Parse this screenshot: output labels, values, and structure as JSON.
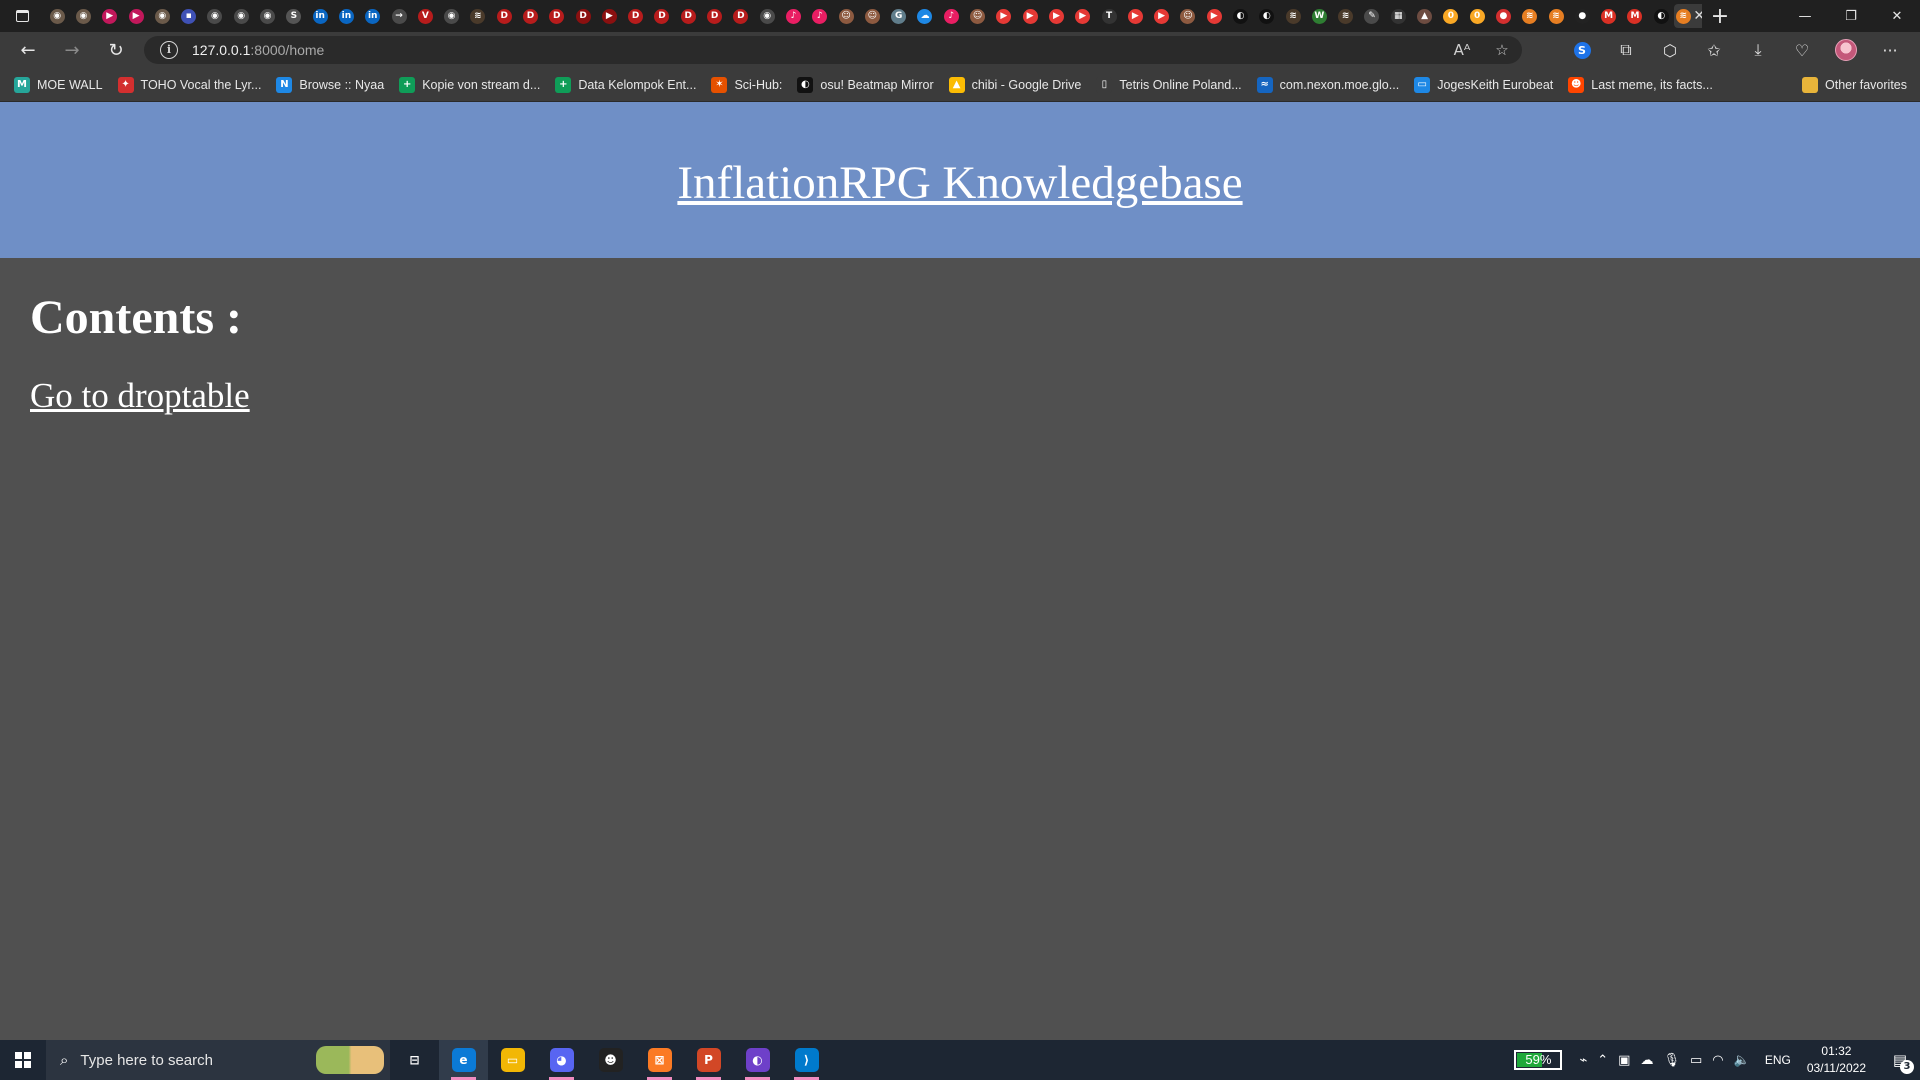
{
  "browser": {
    "tab_favicons": [
      {
        "icon": "eye-icon",
        "color": "#6b5a4a",
        "glyph": "◉"
      },
      {
        "icon": "eye-icon",
        "color": "#6b5a4a",
        "glyph": "◉"
      },
      {
        "icon": "play-icon",
        "color": "#c2185b",
        "glyph": "▶"
      },
      {
        "icon": "play-icon",
        "color": "#c2185b",
        "glyph": "▶"
      },
      {
        "icon": "eye-icon",
        "color": "#6b5a4a",
        "glyph": "◉"
      },
      {
        "icon": "square-app-icon",
        "color": "#3f51b5",
        "glyph": "▪"
      },
      {
        "icon": "eye-icon",
        "color": "#4a4a4a",
        "glyph": "◉"
      },
      {
        "icon": "eye-icon",
        "color": "#4a4a4a",
        "glyph": "◉"
      },
      {
        "icon": "eye-icon",
        "color": "#4a4a4a",
        "glyph": "◉"
      },
      {
        "icon": "s-site-icon",
        "color": "#555555",
        "glyph": "S"
      },
      {
        "icon": "linkedin-icon",
        "color": "#0a66c2",
        "glyph": "in"
      },
      {
        "icon": "linkedin-icon",
        "color": "#0a66c2",
        "glyph": "in"
      },
      {
        "icon": "linkedin-icon",
        "color": "#0a66c2",
        "glyph": "in"
      },
      {
        "icon": "arrow-site-icon",
        "color": "#4a4a4a",
        "glyph": "→"
      },
      {
        "icon": "v-site-icon",
        "color": "#b71c1c",
        "glyph": "V"
      },
      {
        "icon": "eye-icon",
        "color": "#4a4a4a",
        "glyph": "◉"
      },
      {
        "icon": "stack-icon",
        "color": "#4a3a2a",
        "glyph": "≋"
      },
      {
        "icon": "pdf-icon",
        "color": "#b71c1c",
        "glyph": "D"
      },
      {
        "icon": "pdf-icon",
        "color": "#b71c1c",
        "glyph": "D"
      },
      {
        "icon": "pdf-icon",
        "color": "#b71c1c",
        "glyph": "D"
      },
      {
        "icon": "pdf-icon",
        "color": "#8b1010",
        "glyph": "D"
      },
      {
        "icon": "video-icon",
        "color": "#8b1010",
        "glyph": "▶"
      },
      {
        "icon": "pdf-icon",
        "color": "#b71c1c",
        "glyph": "D"
      },
      {
        "icon": "pdf-icon",
        "color": "#b71c1c",
        "glyph": "D"
      },
      {
        "icon": "pdf-icon",
        "color": "#b71c1c",
        "glyph": "D"
      },
      {
        "icon": "pdf-icon",
        "color": "#b71c1c",
        "glyph": "D"
      },
      {
        "icon": "pdf-icon",
        "color": "#b71c1c",
        "glyph": "D"
      },
      {
        "icon": "eye-icon",
        "color": "#4a4a4a",
        "glyph": "◉"
      },
      {
        "icon": "pink-app-icon",
        "color": "#e91e63",
        "glyph": "♪"
      },
      {
        "icon": "pink-app-icon",
        "color": "#e91e63",
        "glyph": "♪"
      },
      {
        "icon": "face-icon",
        "color": "#8d5a40",
        "glyph": "☺"
      },
      {
        "icon": "face-icon",
        "color": "#8d5a40",
        "glyph": "☺"
      },
      {
        "icon": "globe-icon",
        "color": "#607d8b",
        "glyph": "G"
      },
      {
        "icon": "cloud-icon",
        "color": "#1e88e5",
        "glyph": "☁"
      },
      {
        "icon": "pink-app-icon",
        "color": "#e91e63",
        "glyph": "♪"
      },
      {
        "icon": "face-icon",
        "color": "#8d5a40",
        "glyph": "☺"
      },
      {
        "icon": "youtube-icon",
        "color": "#e53935",
        "glyph": "▶"
      },
      {
        "icon": "youtube-icon",
        "color": "#e53935",
        "glyph": "▶"
      },
      {
        "icon": "youtube-icon",
        "color": "#e53935",
        "glyph": "▶"
      },
      {
        "icon": "youtube-icon",
        "color": "#e53935",
        "glyph": "▶"
      },
      {
        "icon": "t-site-icon",
        "color": "#333333",
        "glyph": "T"
      },
      {
        "icon": "youtube-icon",
        "color": "#e53935",
        "glyph": "▶"
      },
      {
        "icon": "youtube-icon",
        "color": "#e53935",
        "glyph": "▶"
      },
      {
        "icon": "face-icon",
        "color": "#8d5a40",
        "glyph": "☺"
      },
      {
        "icon": "youtube-icon",
        "color": "#e53935",
        "glyph": "▶"
      },
      {
        "icon": "github-icon",
        "color": "#111111",
        "glyph": "◐"
      },
      {
        "icon": "github-icon",
        "color": "#111111",
        "glyph": "◐"
      },
      {
        "icon": "stack-icon",
        "color": "#4a3a2a",
        "glyph": "≋"
      },
      {
        "icon": "w-site-icon",
        "color": "#2e7d32",
        "glyph": "W"
      },
      {
        "icon": "stack-icon",
        "color": "#4a3a2a",
        "glyph": "≋"
      },
      {
        "icon": "pen-icon",
        "color": "#4a4a4a",
        "glyph": "✎"
      },
      {
        "icon": "grid-icon",
        "color": "#333333",
        "glyph": "▦"
      },
      {
        "icon": "mountain-icon",
        "color": "#6d4c41",
        "glyph": "▲"
      },
      {
        "icon": "zero-icon",
        "color": "#f9a825",
        "glyph": "0"
      },
      {
        "icon": "zero-icon",
        "color": "#f9a825",
        "glyph": "0"
      },
      {
        "icon": "strawberry-icon",
        "color": "#d32f2f",
        "glyph": "●"
      },
      {
        "icon": "stack-icon",
        "color": "#e67e22",
        "glyph": "≋"
      },
      {
        "icon": "stack-icon",
        "color": "#e67e22",
        "glyph": "≋"
      },
      {
        "icon": "dark-circle-icon",
        "color": "#222222",
        "glyph": "●"
      },
      {
        "icon": "gmail-icon",
        "color": "#d93025",
        "glyph": "M"
      },
      {
        "icon": "gmail-icon",
        "color": "#d93025",
        "glyph": "M"
      },
      {
        "icon": "github-icon",
        "color": "#111111",
        "glyph": "◐"
      }
    ],
    "active_tab": {
      "icon": "stack-icon",
      "color": "#e67e22",
      "glyph": "≋",
      "close": "✕"
    },
    "new_tab": "+",
    "window_controls": {
      "minimize": "—",
      "restore": "❐",
      "close": "✕"
    },
    "address": {
      "host": "127.0.0.1",
      "path": ":8000/home"
    },
    "nav": {
      "back": "←",
      "forward": "→",
      "reload": "↻"
    },
    "omnibox_icons": {
      "read_aloud": "Aᴬ",
      "favorite_add": "☆"
    },
    "toolbar_icons": {
      "shazam": "S",
      "media": "⧉",
      "extensions": "⬡",
      "favorites": "✩",
      "downloads": "⤓",
      "browser_essentials": "♡",
      "more": "···"
    },
    "bookmarks": [
      {
        "label": "MOE WALL",
        "icon": "moe-wall-icon",
        "color": "#26a69a",
        "glyph": "M"
      },
      {
        "label": "TOHO Vocal the Lyr...",
        "icon": "touhou-icon",
        "color": "#d32f2f",
        "glyph": "✦"
      },
      {
        "label": "Browse :: Nyaa",
        "icon": "nyaa-icon",
        "color": "#1e88e5",
        "glyph": "N"
      },
      {
        "label": "Kopie von stream d...",
        "icon": "sheets-icon",
        "color": "#0f9d58",
        "glyph": "+"
      },
      {
        "label": "Data Kelompok Ent...",
        "icon": "sheets-icon",
        "color": "#0f9d58",
        "glyph": "+"
      },
      {
        "label": "Sci-Hub:",
        "icon": "scihub-icon",
        "color": "#e65100",
        "glyph": "✶"
      },
      {
        "label": "osu! Beatmap Mirror",
        "icon": "github-icon",
        "color": "#111111",
        "glyph": "◐"
      },
      {
        "label": "chibi - Google Drive",
        "icon": "google-drive-icon",
        "color": "#fbbc04",
        "glyph": "▲"
      },
      {
        "label": "Tetris Online Poland...",
        "icon": "page-icon",
        "color": "#3b3b3b",
        "glyph": "▯"
      },
      {
        "label": "com.nexon.moe.glo...",
        "icon": "swoosh-icon",
        "color": "#1565c0",
        "glyph": "≈"
      },
      {
        "label": "JogesKeith Eurobeat",
        "icon": "tv-icon",
        "color": "#1e88e5",
        "glyph": "▭"
      },
      {
        "label": "Last meme, its facts...",
        "icon": "reddit-icon",
        "color": "#ff4500",
        "glyph": "☻"
      }
    ],
    "other_favorites": {
      "label": "Other favorites",
      "icon": "folder-icon",
      "color": "#e8b43a",
      "glyph": "▬"
    }
  },
  "page": {
    "title": "InflationRPG Knowledgebase",
    "contents_heading": "Contents :",
    "droptable_link": "Go to droptable",
    "header_color": "#6f8fc6",
    "body_color": "#505050"
  },
  "taskbar": {
    "search_placeholder": "Type here to search",
    "apps": [
      {
        "name": "task-view-icon",
        "color": "transparent",
        "glyph": "⊟",
        "active": false,
        "running": false
      },
      {
        "name": "edge-icon",
        "color": "#0b7ad6",
        "glyph": "e",
        "active": true,
        "running": true
      },
      {
        "name": "file-explorer-icon",
        "color": "#f2b705",
        "glyph": "▭",
        "active": false,
        "running": false
      },
      {
        "name": "discord-icon",
        "color": "#5865f2",
        "glyph": "◕",
        "active": false,
        "running": true
      },
      {
        "name": "osu-character-icon",
        "color": "#222222",
        "glyph": "☻",
        "active": false,
        "running": false
      },
      {
        "name": "xampp-icon",
        "color": "#fb7a24",
        "glyph": "⊠",
        "active": false,
        "running": true
      },
      {
        "name": "powerpoint-icon",
        "color": "#d24726",
        "glyph": "P",
        "active": false,
        "running": true
      },
      {
        "name": "github-desktop-icon",
        "color": "#6e40c9",
        "glyph": "◐",
        "active": false,
        "running": true
      },
      {
        "name": "vscode-icon",
        "color": "#007acc",
        "glyph": "⟩",
        "active": false,
        "running": true
      }
    ],
    "battery_percent": 59,
    "battery_label": "59%",
    "tray_icons": {
      "power": "⌁",
      "chevron": "⌃",
      "device": "▣",
      "cloud": "☁",
      "mic": "🎙",
      "battery_saver": "▭",
      "wifi": "◠",
      "volume": "🔈"
    },
    "language": "ENG",
    "time": "01:32",
    "date": "03/11/2022",
    "notification_count": "3",
    "notification_icon": "▤"
  }
}
